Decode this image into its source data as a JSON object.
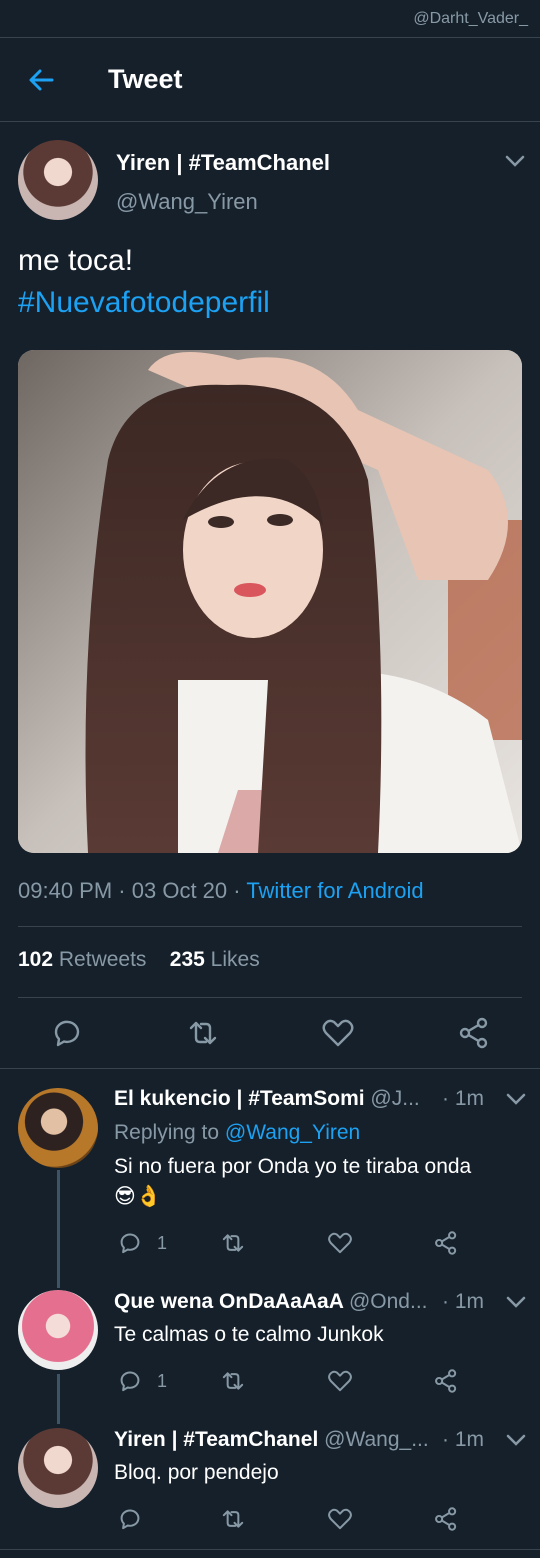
{
  "watermark": "@Darht_Vader_",
  "header": {
    "title": "Tweet",
    "back_icon": "arrow-left-icon"
  },
  "tweet": {
    "author_name": "Yiren | #TeamChanel",
    "author_handle": "@Wang_Yiren",
    "text_line1": "me toca!",
    "hashtag": "#Nuevafotodeperfil",
    "time": "09:40 PM",
    "date": "03 Oct 20",
    "source": "Twitter for Android",
    "retweets_count": "102",
    "retweets_label": "Retweets",
    "likes_count": "235",
    "likes_label": "Likes"
  },
  "replies": [
    {
      "name": "El kukencio | #TeamSomi",
      "handle": "@J...",
      "time": "1m",
      "replying_prefix": "Replying to",
      "replying_to": "@Wang_Yiren",
      "text": "Si no fuera por Onda yo te tiraba onda",
      "emoji": "😎👌",
      "reply_count": "1"
    },
    {
      "name": "Que wena OnDaAaAaA",
      "handle": "@Ond...",
      "time": "1m",
      "text": "Te calmas o te calmo Junkok",
      "reply_count": "1"
    },
    {
      "name": "Yiren | #TeamChanel",
      "handle": "@Wang_...",
      "time": "1m",
      "text": "Bloq. por pendejo",
      "reply_count": ""
    }
  ],
  "colors": {
    "background": "#15202b",
    "accent": "#1da1f2",
    "muted": "#8899a6",
    "divider": "#38444d"
  }
}
